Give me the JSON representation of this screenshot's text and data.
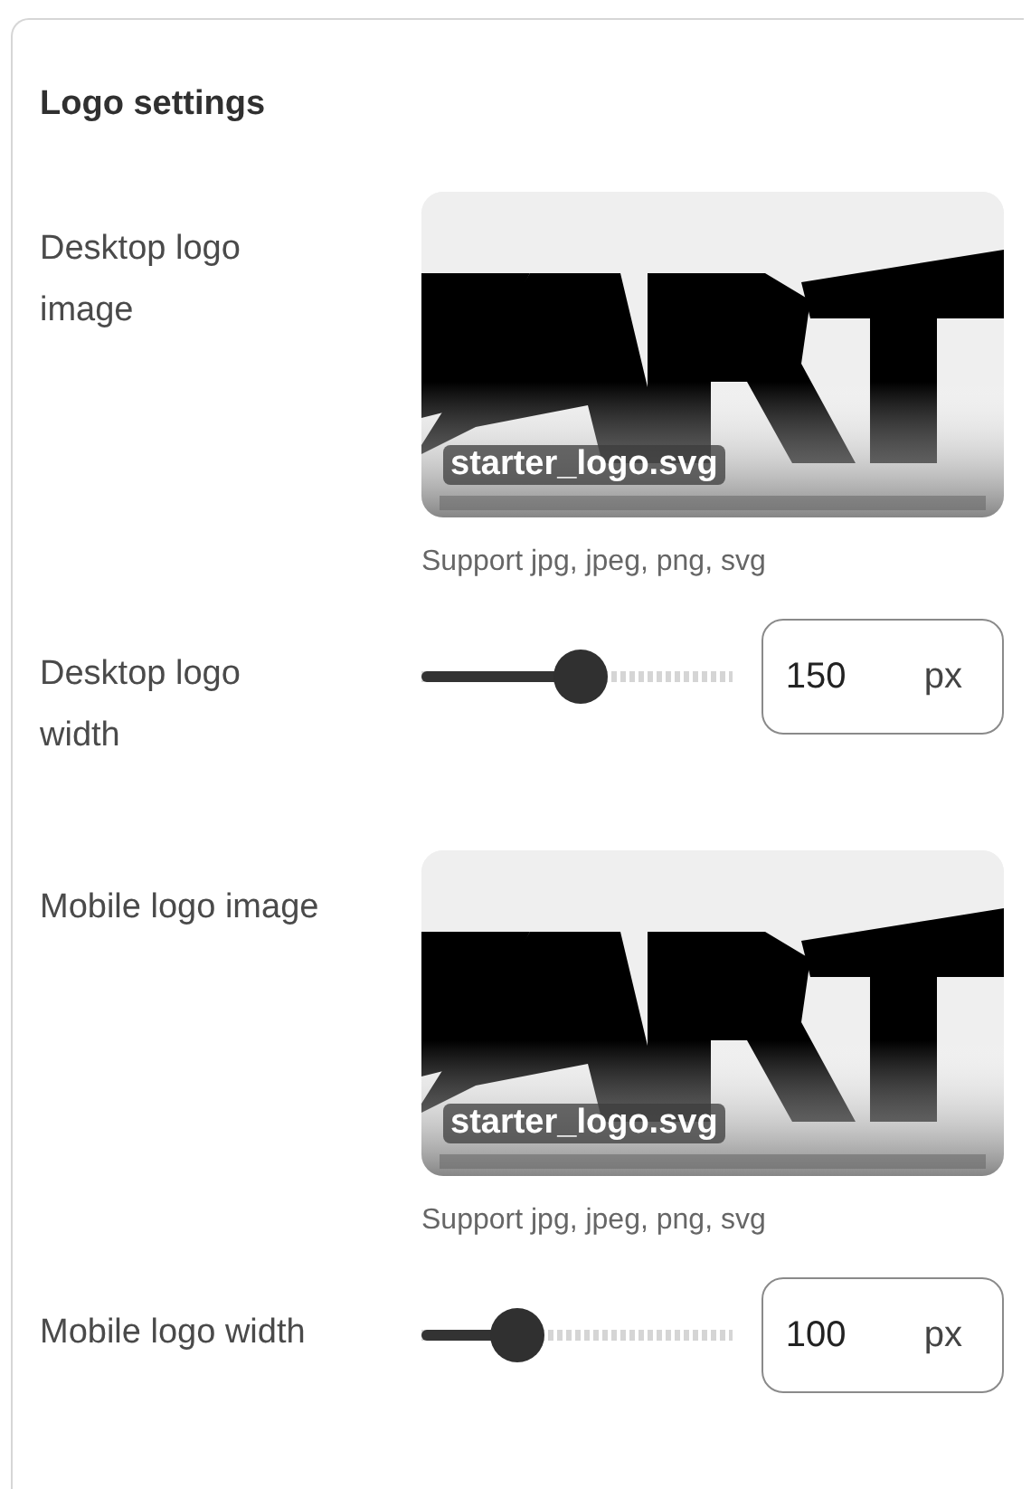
{
  "section": {
    "title": "Logo settings"
  },
  "rows": [
    {
      "label": "Desktop logo image",
      "filename": "starter_logo.svg",
      "help": "Support jpg, jpeg, png, svg"
    },
    {
      "kind": "slider",
      "label": "Desktop logo width",
      "level": 0.51,
      "value": "150",
      "unit": "px"
    },
    {
      "label": "Mobile logo image",
      "filename": "starter_logo.svg",
      "help": "Support jpg, jpeg, png, svg"
    },
    {
      "kind": "slider",
      "label": "Mobile logo width",
      "level": 0.31,
      "value": "100",
      "unit": "px"
    }
  ]
}
